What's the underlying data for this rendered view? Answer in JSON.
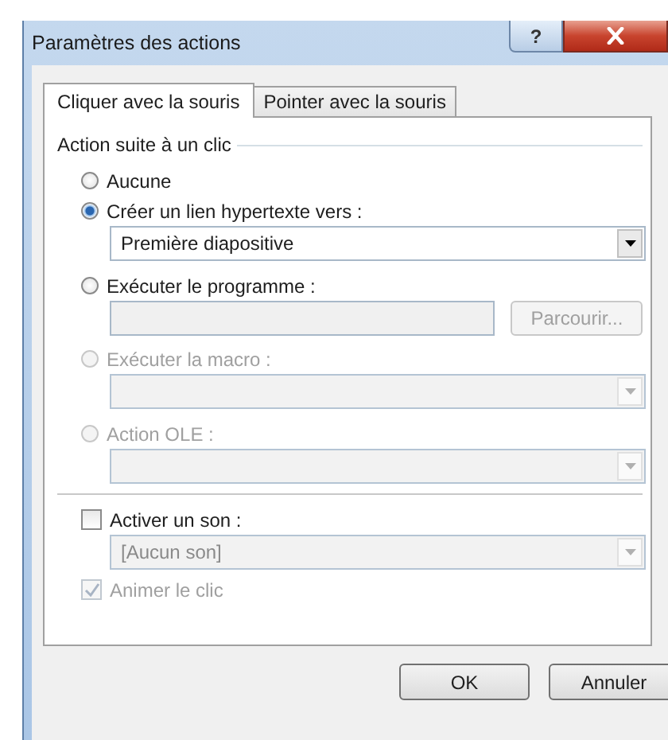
{
  "window": {
    "title": "Paramètres des actions",
    "help_button": "?"
  },
  "tabs": [
    {
      "label": "Cliquer avec la souris",
      "selected": true
    },
    {
      "label": "Pointer avec la souris",
      "selected": false
    }
  ],
  "action_group": {
    "title": "Action suite à un clic",
    "options": [
      {
        "label": "Aucune",
        "selected": false,
        "disabled": false
      },
      {
        "label": "Créer un lien hypertexte vers :",
        "selected": true,
        "disabled": false,
        "control": {
          "kind": "dropdown",
          "value": "Première diapositive",
          "disabled": false
        }
      },
      {
        "label": "Exécuter le programme :",
        "selected": false,
        "disabled": false,
        "control": {
          "kind": "browse",
          "button": "Parcourir...",
          "disabled": true
        }
      },
      {
        "label": "Exécuter la macro :",
        "selected": false,
        "disabled": true,
        "control": {
          "kind": "dropdown",
          "disabled": true
        }
      },
      {
        "label": "Action OLE :",
        "selected": false,
        "disabled": true,
        "control": {
          "kind": "dropdown",
          "disabled": true
        }
      }
    ]
  },
  "sound": {
    "label": "Activer un son :",
    "checked": false,
    "disabled": false,
    "dropdown": {
      "value": "[Aucun son]",
      "disabled": true
    }
  },
  "animate": {
    "label": "Animer le clic",
    "checked": true,
    "disabled": true
  },
  "buttons": [
    {
      "label": "OK"
    },
    {
      "label": "Annuler"
    }
  ]
}
